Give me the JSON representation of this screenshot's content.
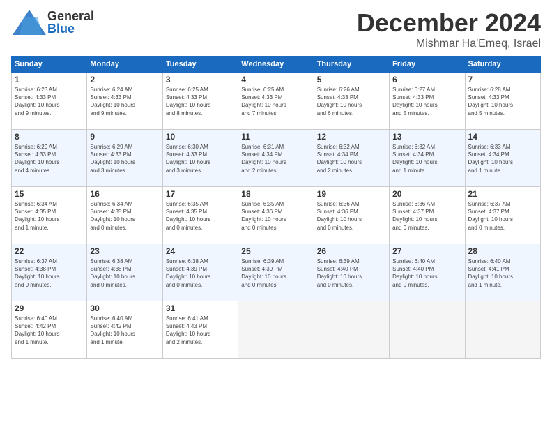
{
  "logo": {
    "general": "General",
    "blue": "Blue",
    "icon_color": "#1a6bbf"
  },
  "header": {
    "month": "December 2024",
    "location": "Mishmar Ha'Emeq, Israel"
  },
  "weekdays": [
    "Sunday",
    "Monday",
    "Tuesday",
    "Wednesday",
    "Thursday",
    "Friday",
    "Saturday"
  ],
  "weeks": [
    [
      {
        "day": "1",
        "sunrise": "6:23 AM",
        "sunset": "4:33 PM",
        "daylight": "10 hours and 9 minutes."
      },
      {
        "day": "2",
        "sunrise": "6:24 AM",
        "sunset": "4:33 PM",
        "daylight": "10 hours and 9 minutes."
      },
      {
        "day": "3",
        "sunrise": "6:25 AM",
        "sunset": "4:33 PM",
        "daylight": "10 hours and 8 minutes."
      },
      {
        "day": "4",
        "sunrise": "6:25 AM",
        "sunset": "4:33 PM",
        "daylight": "10 hours and 7 minutes."
      },
      {
        "day": "5",
        "sunrise": "6:26 AM",
        "sunset": "4:33 PM",
        "daylight": "10 hours and 6 minutes."
      },
      {
        "day": "6",
        "sunrise": "6:27 AM",
        "sunset": "4:33 PM",
        "daylight": "10 hours and 5 minutes."
      },
      {
        "day": "7",
        "sunrise": "6:28 AM",
        "sunset": "4:33 PM",
        "daylight": "10 hours and 5 minutes."
      }
    ],
    [
      {
        "day": "8",
        "sunrise": "6:29 AM",
        "sunset": "4:33 PM",
        "daylight": "10 hours and 4 minutes."
      },
      {
        "day": "9",
        "sunrise": "6:29 AM",
        "sunset": "4:33 PM",
        "daylight": "10 hours and 3 minutes."
      },
      {
        "day": "10",
        "sunrise": "6:30 AM",
        "sunset": "4:33 PM",
        "daylight": "10 hours and 3 minutes."
      },
      {
        "day": "11",
        "sunrise": "6:31 AM",
        "sunset": "4:34 PM",
        "daylight": "10 hours and 2 minutes."
      },
      {
        "day": "12",
        "sunrise": "6:32 AM",
        "sunset": "4:34 PM",
        "daylight": "10 hours and 2 minutes."
      },
      {
        "day": "13",
        "sunrise": "6:32 AM",
        "sunset": "4:34 PM",
        "daylight": "10 hours and 1 minute."
      },
      {
        "day": "14",
        "sunrise": "6:33 AM",
        "sunset": "4:34 PM",
        "daylight": "10 hours and 1 minute."
      }
    ],
    [
      {
        "day": "15",
        "sunrise": "6:34 AM",
        "sunset": "4:35 PM",
        "daylight": "10 hours and 1 minute."
      },
      {
        "day": "16",
        "sunrise": "6:34 AM",
        "sunset": "4:35 PM",
        "daylight": "10 hours and 0 minutes."
      },
      {
        "day": "17",
        "sunrise": "6:35 AM",
        "sunset": "4:35 PM",
        "daylight": "10 hours and 0 minutes."
      },
      {
        "day": "18",
        "sunrise": "6:35 AM",
        "sunset": "4:36 PM",
        "daylight": "10 hours and 0 minutes."
      },
      {
        "day": "19",
        "sunrise": "6:36 AM",
        "sunset": "4:36 PM",
        "daylight": "10 hours and 0 minutes."
      },
      {
        "day": "20",
        "sunrise": "6:36 AM",
        "sunset": "4:37 PM",
        "daylight": "10 hours and 0 minutes."
      },
      {
        "day": "21",
        "sunrise": "6:37 AM",
        "sunset": "4:37 PM",
        "daylight": "10 hours and 0 minutes."
      }
    ],
    [
      {
        "day": "22",
        "sunrise": "6:37 AM",
        "sunset": "4:38 PM",
        "daylight": "10 hours and 0 minutes."
      },
      {
        "day": "23",
        "sunrise": "6:38 AM",
        "sunset": "4:38 PM",
        "daylight": "10 hours and 0 minutes."
      },
      {
        "day": "24",
        "sunrise": "6:38 AM",
        "sunset": "4:39 PM",
        "daylight": "10 hours and 0 minutes."
      },
      {
        "day": "25",
        "sunrise": "6:39 AM",
        "sunset": "4:39 PM",
        "daylight": "10 hours and 0 minutes."
      },
      {
        "day": "26",
        "sunrise": "6:39 AM",
        "sunset": "4:40 PM",
        "daylight": "10 hours and 0 minutes."
      },
      {
        "day": "27",
        "sunrise": "6:40 AM",
        "sunset": "4:40 PM",
        "daylight": "10 hours and 0 minutes."
      },
      {
        "day": "28",
        "sunrise": "6:40 AM",
        "sunset": "4:41 PM",
        "daylight": "10 hours and 1 minute."
      }
    ],
    [
      {
        "day": "29",
        "sunrise": "6:40 AM",
        "sunset": "4:42 PM",
        "daylight": "10 hours and 1 minute."
      },
      {
        "day": "30",
        "sunrise": "6:40 AM",
        "sunset": "4:42 PM",
        "daylight": "10 hours and 1 minute."
      },
      {
        "day": "31",
        "sunrise": "6:41 AM",
        "sunset": "4:43 PM",
        "daylight": "10 hours and 2 minutes."
      },
      null,
      null,
      null,
      null
    ]
  ],
  "labels": {
    "sunrise_prefix": "Sunrise: ",
    "sunset_prefix": "Sunset: ",
    "daylight_prefix": "Daylight: "
  }
}
